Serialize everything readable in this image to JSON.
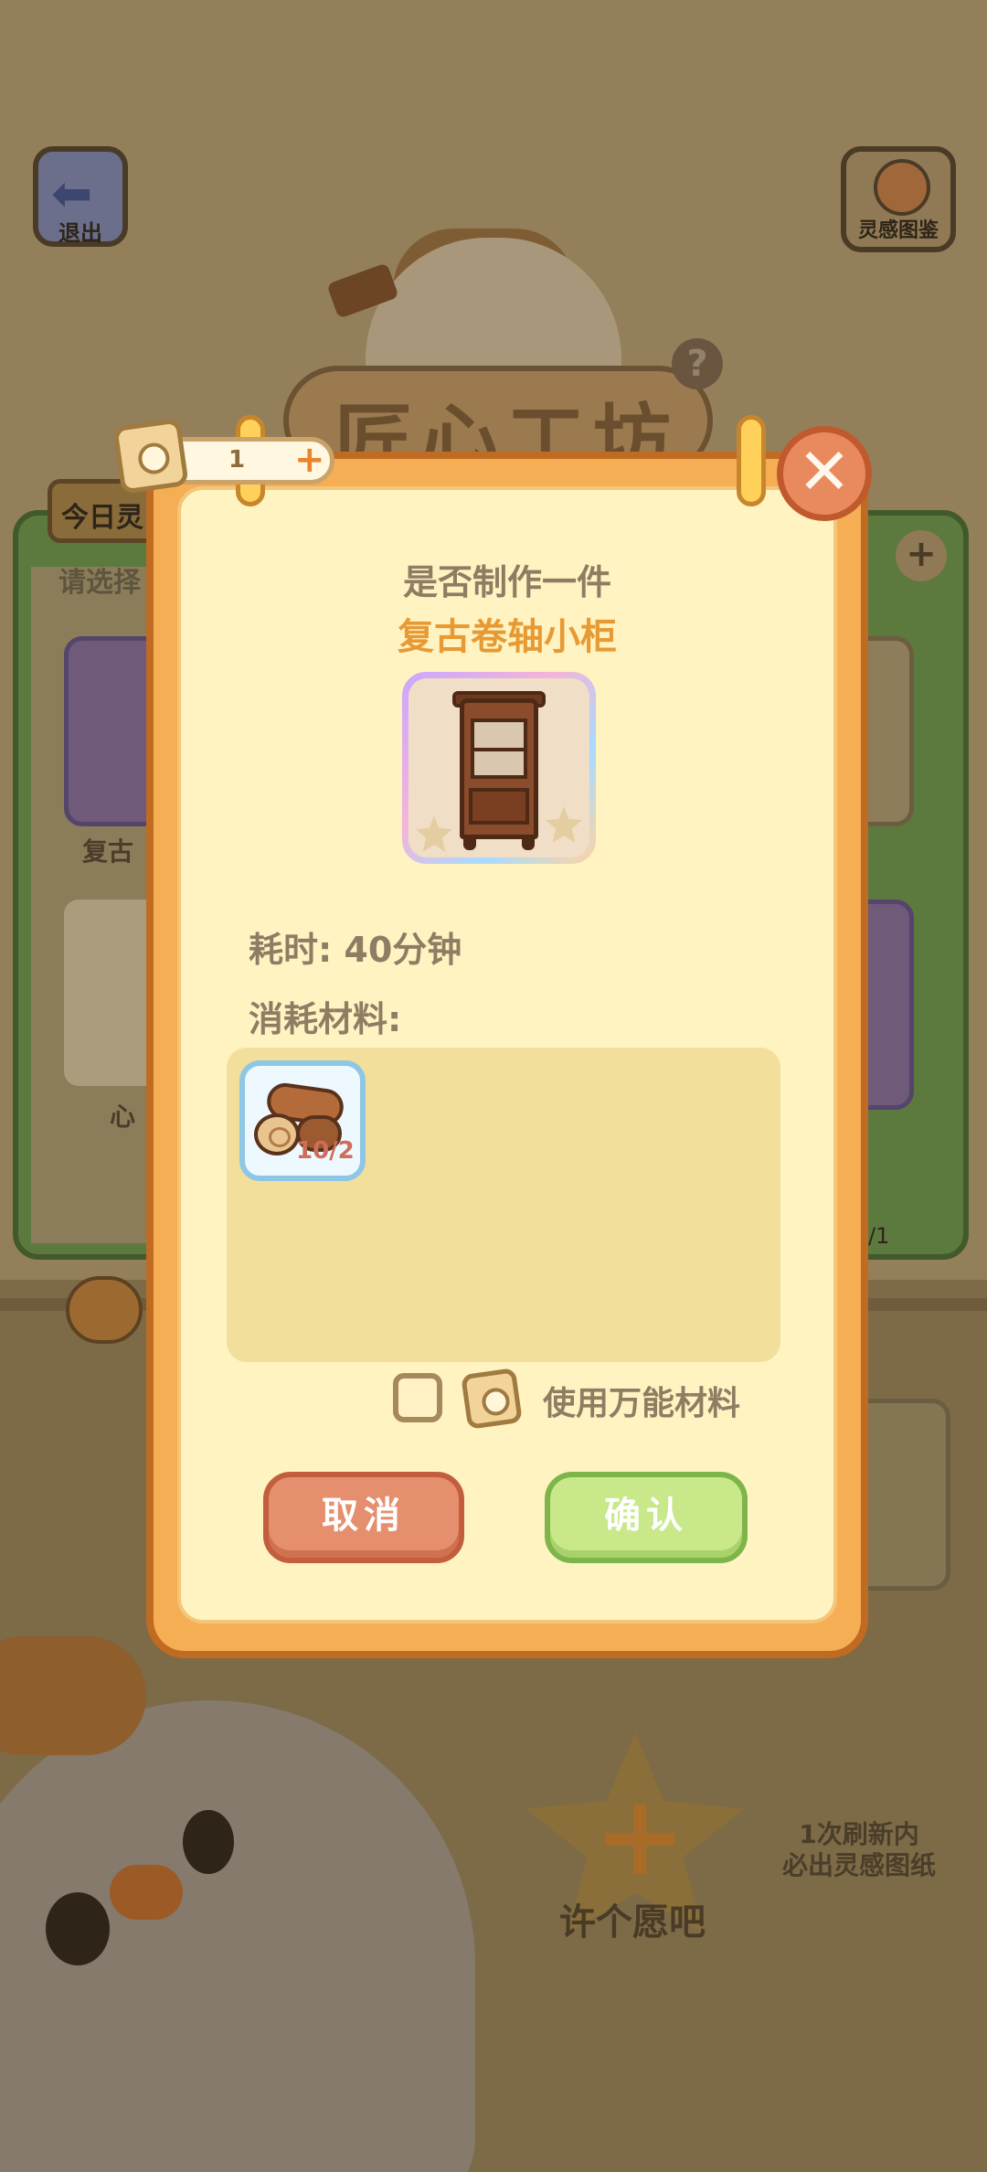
{
  "background": {
    "exit_label": "退出",
    "inspiration_label": "灵感图鉴",
    "workshop_sign": "匠心工坊",
    "today_tab": "今日灵",
    "pick_hint": "请选择",
    "left_card1_label": "复古",
    "left_card2_label": "心",
    "right_count": "/1",
    "wish_label": "许个愿吧",
    "refresh_line1": "1次刷新内",
    "refresh_line2": "必出灵感图纸",
    "help_glyph": "?",
    "plus_glyph": "+"
  },
  "ticket": {
    "count": "1",
    "plus": "+",
    "icon": "blueprint-ticket-icon"
  },
  "dialog": {
    "question": "是否制作一件",
    "item_name": "复古卷轴小柜",
    "item_icon": "cabinet-icon",
    "time_text": "耗时: 40分钟",
    "materials_title": "消耗材料:",
    "materials": [
      {
        "icon": "wood-log-icon",
        "count": "10/2"
      }
    ],
    "use_universal_label": "使用万能材料",
    "use_universal_checked": false,
    "cancel_label": "取消",
    "confirm_label": "确认",
    "close_glyph": "✕"
  },
  "colors": {
    "accent_orange": "#e79a34",
    "cancel": "#e68f6e",
    "confirm": "#c8e88a",
    "panel": "#fff3c2"
  }
}
